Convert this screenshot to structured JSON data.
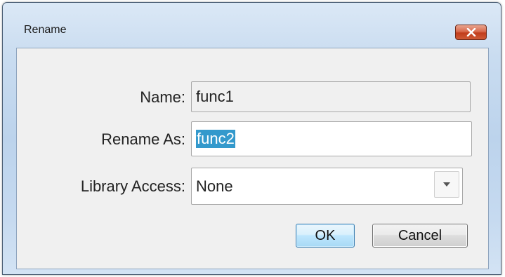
{
  "window": {
    "title": "Rename"
  },
  "form": {
    "name_label": "Name:",
    "name_value": "func1",
    "rename_as_label": "Rename As:",
    "rename_as_value": "func2",
    "library_access_label": "Library Access:",
    "library_access_value": "None"
  },
  "buttons": {
    "ok_label": "OK",
    "cancel_label": "Cancel"
  },
  "icons": {
    "close": "close-icon",
    "dropdown": "chevron-down-icon"
  },
  "colors": {
    "selection": "#3399cc",
    "close_button": "#c13d1c"
  }
}
